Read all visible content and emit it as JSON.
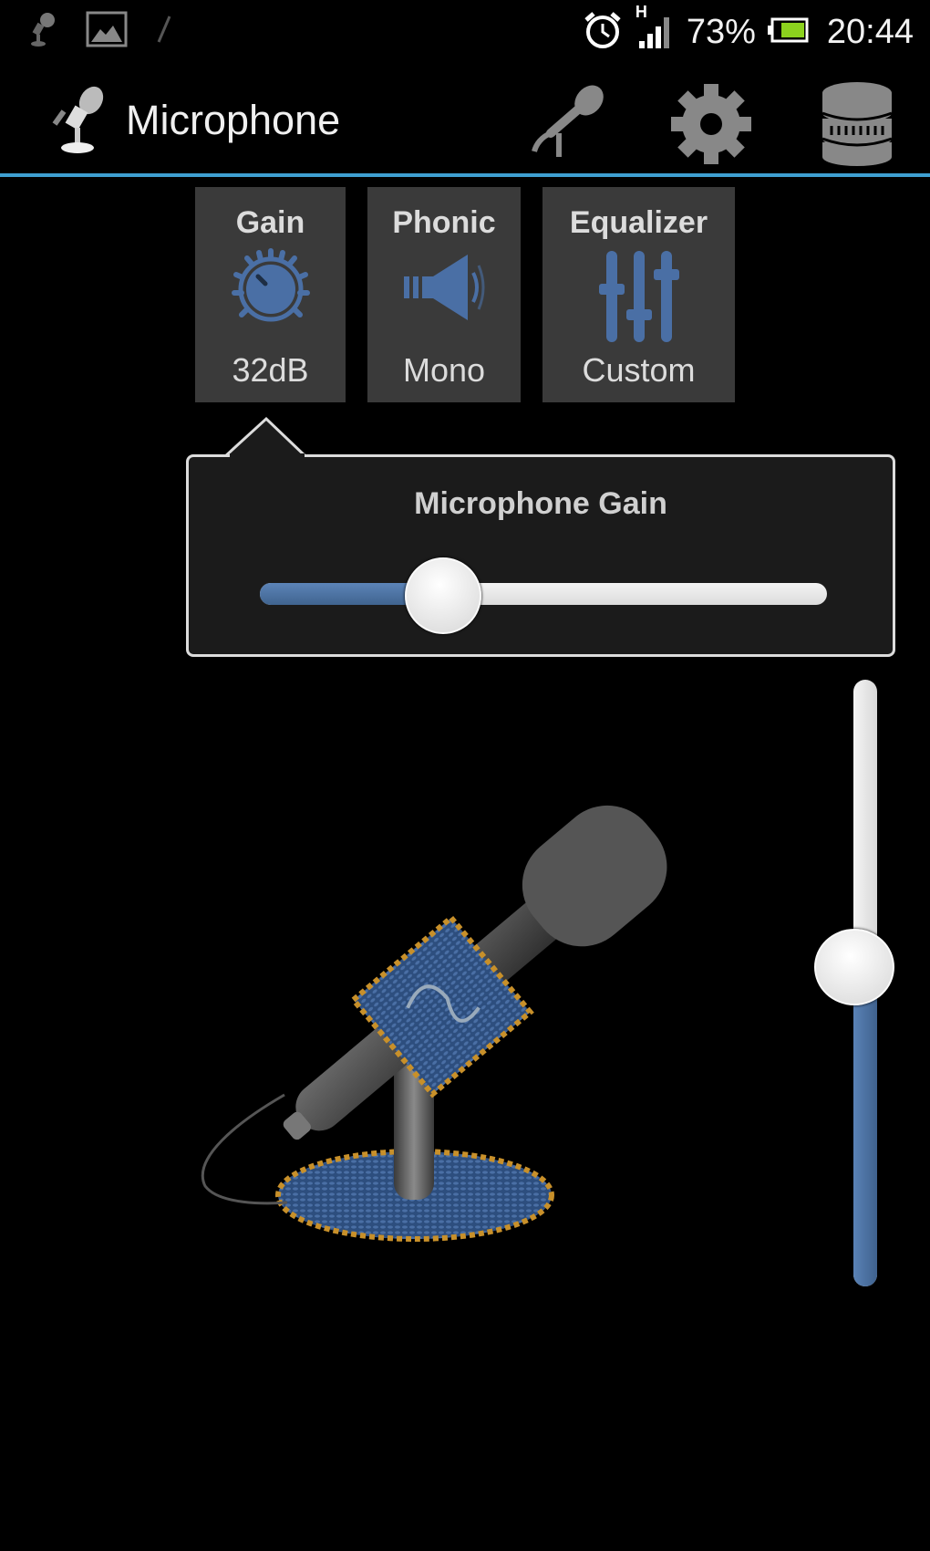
{
  "status_bar": {
    "left_icons": [
      "microphone-notification-icon",
      "image-notification-icon",
      "feather-notification-icon"
    ],
    "right_icons": [
      "alarm-icon",
      "signal-icon",
      "battery-icon"
    ],
    "network_type": "H",
    "battery_percent": "73%",
    "time": "20:44",
    "battery_color": "#8cd21e"
  },
  "action_bar": {
    "title": "Microphone",
    "logo_icon": "microphone-stand-logo-icon",
    "actions": [
      {
        "name": "microphone-action",
        "icon": "microphone-icon"
      },
      {
        "name": "settings-action",
        "icon": "gear-icon"
      },
      {
        "name": "storage-action",
        "icon": "database-icon"
      }
    ],
    "divider_color": "#3e9fd1"
  },
  "tiles": [
    {
      "title": "Gain",
      "value": "32dB",
      "icon": "knob-icon"
    },
    {
      "title": "Phonic",
      "value": "Mono",
      "icon": "speaker-icon"
    },
    {
      "title": "Equalizer",
      "value": "Custom",
      "icon": "equalizer-icon"
    }
  ],
  "gain_popup": {
    "title": "Microphone Gain",
    "slider_fraction": 0.32
  },
  "volume_slider": {
    "fraction": 0.53
  },
  "illustration": {
    "name": "desk microphone illustration"
  },
  "colors": {
    "accent_blue": "#4a6fa5",
    "tile_bg": "#3a3a3a",
    "popup_bg": "#1b1b1b"
  }
}
